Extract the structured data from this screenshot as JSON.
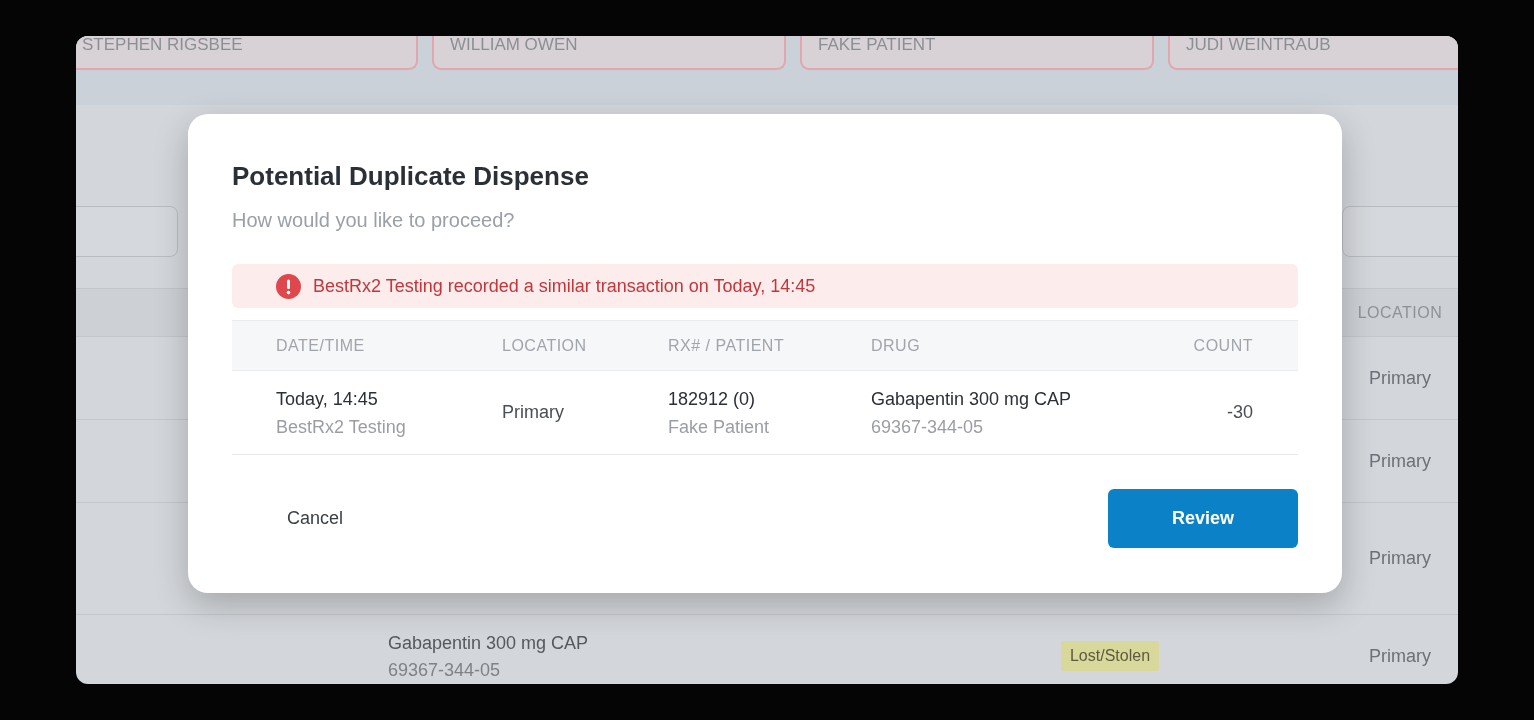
{
  "patient_tabs": [
    {
      "name": "STEPHEN RIGSBEE"
    },
    {
      "name": "WILLIAM OWEN"
    },
    {
      "name": "FAKE PATIENT"
    },
    {
      "name": "JUDI WEINTRAUB"
    }
  ],
  "background_table": {
    "location_header": "LOCATION",
    "rows": [
      {
        "location": "Primary"
      },
      {
        "location": "Primary"
      },
      {
        "location": "Primary"
      },
      {
        "drug": "Gabapentin 300 mg CAP",
        "ndc": "69367-344-05",
        "reason": "Lost/Stolen",
        "location": "Primary"
      }
    ]
  },
  "dialog": {
    "title": "Potential Duplicate Dispense",
    "subtitle": "How would you like to proceed?",
    "alert": "BestRx2 Testing recorded a similar transaction on Today, 14:45",
    "table": {
      "columns": [
        "DATE/TIME",
        "LOCATION",
        "RX# / PATIENT",
        "DRUG",
        "COUNT"
      ],
      "rows": [
        {
          "date": "Today, 14:45",
          "source": "BestRx2 Testing",
          "location": "Primary",
          "rx": "182912 (0)",
          "patient": "Fake Patient",
          "drug": "Gabapentin 300 mg CAP",
          "ndc": "69367-344-05",
          "count": "-30"
        }
      ]
    },
    "buttons": [
      {
        "label": "Cancel",
        "kind": "secondary"
      },
      {
        "label": "Review",
        "kind": "primary"
      }
    ]
  }
}
